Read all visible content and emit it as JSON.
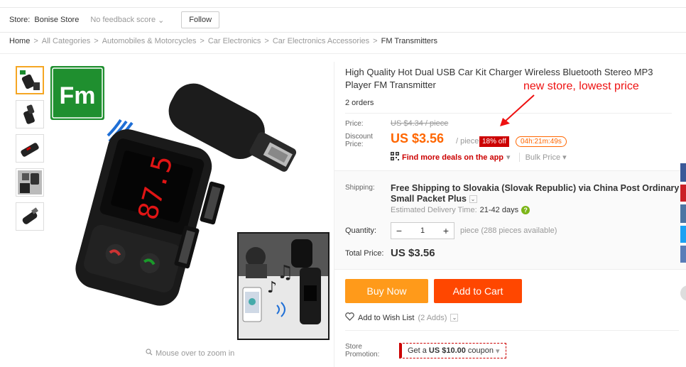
{
  "store": {
    "label": "Store:",
    "name": "Bonise Store",
    "feedback": "No feedback score",
    "follow": "Follow"
  },
  "breadcrumb": {
    "items": [
      "Home",
      "All Categories",
      "Automobiles & Motorcycles",
      "Car Electronics",
      "Car Electronics Accessories",
      "FM Transmitters"
    ],
    "separator": ">"
  },
  "gallery": {
    "logo_text": "Fm",
    "display_reading": "87.5",
    "zoom_hint": "Mouse over to zoom in"
  },
  "product": {
    "title": "High Quality Hot Dual USB Car Kit Charger Wireless Bluetooth Stereo MP3 Player FM Transmitter",
    "orders": "2 orders"
  },
  "annotation": {
    "text": "new store, lowest price",
    "color": "#ee1111"
  },
  "pricing": {
    "price_label": "Price:",
    "original_price": "US $4.34 / piece",
    "discount_label": "Discount Price:",
    "discount_price": "US $3.56",
    "per_unit": "/ piece",
    "discount_badge": "18% off",
    "countdown": "04h:21m:49s",
    "app_deals": "Find more deals on the app",
    "bulk_price": "Bulk Price"
  },
  "shipping": {
    "label": "Shipping:",
    "value": "Free Shipping to Slovakia (Slovak Republic) via China Post Ordinary Small Packet Plus",
    "est_label": "Estimated Delivery Time:",
    "est_days": "21-42 days"
  },
  "quantity": {
    "label": "Quantity:",
    "value": "1",
    "minus": "−",
    "plus": "+",
    "available": "piece (288 pieces available)"
  },
  "total": {
    "label": "Total Price:",
    "value": "US $3.56"
  },
  "actions": {
    "buy_now": "Buy Now",
    "add_to_cart": "Add to Cart",
    "wish_list": "Add to Wish List",
    "wish_count": "(2 Adds)"
  },
  "promotion": {
    "label": "Store Promotion:",
    "coupon_prefix": "Get a",
    "coupon_amount": "US $10.00",
    "coupon_suffix": "coupon"
  },
  "colors": {
    "accent_orange": "#ff6600",
    "buy_now": "#ff9a1a",
    "add_to_cart": "#ff4700",
    "badge_red": "#cc0000"
  }
}
